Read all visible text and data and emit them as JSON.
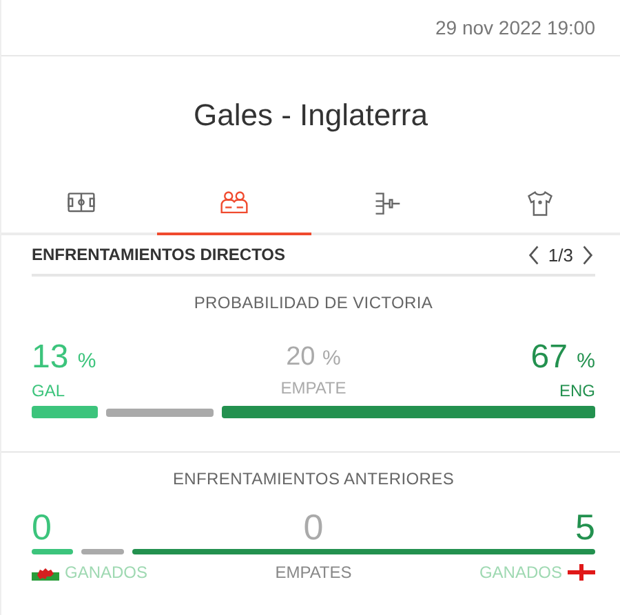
{
  "datetime": "29 nov 2022 19:00",
  "title": "Gales - Inglaterra",
  "tabs": [
    {
      "kind": "field",
      "selected": false
    },
    {
      "kind": "players",
      "selected": true
    },
    {
      "kind": "bracket",
      "selected": false
    },
    {
      "kind": "shirt",
      "selected": false
    }
  ],
  "section": {
    "title": "ENFRENTAMIENTOS DIRECTOS",
    "page": "1/3"
  },
  "probability": {
    "title": "PROBABILIDAD DE VICTORIA",
    "items": [
      {
        "kind": "home",
        "value": "13",
        "unit": "%",
        "label": "GAL",
        "color": "#3cc47c"
      },
      {
        "kind": "draw",
        "value": "20",
        "unit": "%",
        "label": "EMPATE",
        "color": "#aaaaaa"
      },
      {
        "kind": "away",
        "value": "67",
        "unit": "%",
        "label": "ENG",
        "color": "#23914f"
      }
    ]
  },
  "previous": {
    "title": "ENFRENTAMIENTOS ANTERIORES",
    "items": [
      {
        "kind": "home",
        "value": "0",
        "label": "GANADOS",
        "color": "#3cc47c"
      },
      {
        "kind": "draw",
        "value": "0",
        "label": "EMPATES",
        "color": "#aaaaaa"
      },
      {
        "kind": "away",
        "value": "5",
        "label": "GANADOS",
        "color": "#23914f"
      }
    ]
  }
}
